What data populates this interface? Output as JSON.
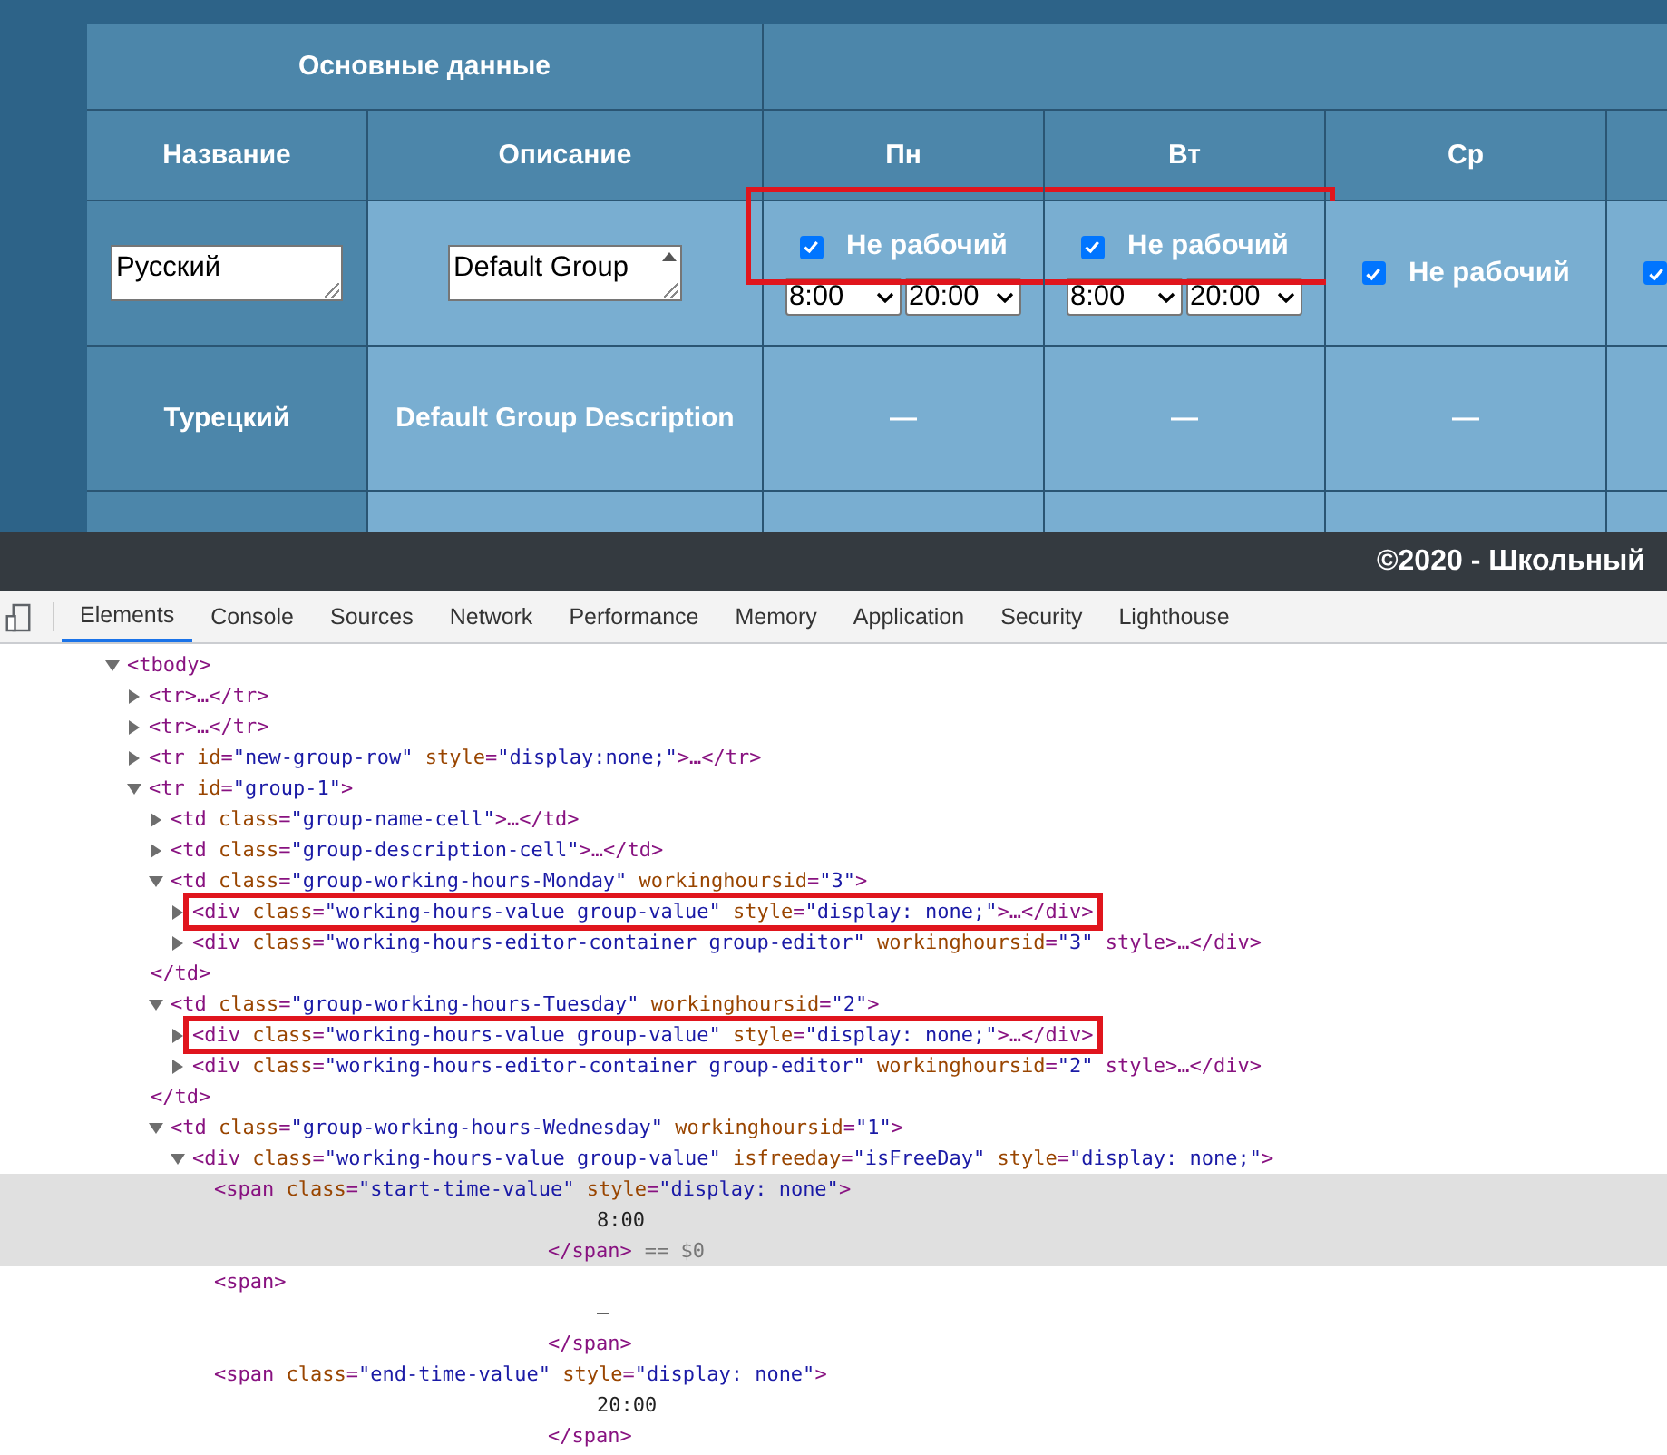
{
  "table": {
    "group_header": "Основные данные",
    "columns": [
      "Название",
      "Описание"
    ],
    "days": [
      {
        "label": "Пн",
        "not_working_label": "Не рабочий",
        "checked": true,
        "start": "8:00",
        "end": "20:00",
        "highlighted": true,
        "dash": "—"
      },
      {
        "label": "Вт",
        "not_working_label": "Не рабочий",
        "checked": true,
        "start": "8:00",
        "end": "20:00",
        "highlighted": true,
        "dash": "—"
      },
      {
        "label": "Ср",
        "not_working_label": "Не рабочий",
        "checked": true,
        "highlighted": false,
        "dash": "—"
      },
      {
        "checked": true,
        "highlighted": false
      }
    ],
    "editor_row": {
      "name": "Русский",
      "description": "Default Group"
    },
    "rows": [
      {
        "name": "Турецкий",
        "description": "Default Group Description"
      }
    ]
  },
  "footer": "©2020 - Школьный",
  "devtools": {
    "tabs": [
      {
        "label": "Elements",
        "selected": true
      },
      {
        "label": "Console",
        "selected": false
      },
      {
        "label": "Sources",
        "selected": false
      },
      {
        "label": "Network",
        "selected": false
      },
      {
        "label": "Performance",
        "selected": false
      },
      {
        "label": "Memory",
        "selected": false
      },
      {
        "label": "Application",
        "selected": false
      },
      {
        "label": "Security",
        "selected": false
      },
      {
        "label": "Lighthouse",
        "selected": false
      }
    ],
    "tree": [
      {
        "text": "<tbody>",
        "expanded": true,
        "children": [
          {
            "text": "<tr>…</tr>",
            "expanded": false
          },
          {
            "text": "<tr>…</tr>",
            "expanded": false
          },
          {
            "text": "<tr id=\"new-group-row\" style=\"display:none;\">…</tr>",
            "expanded": false
          },
          {
            "text": "<tr id=\"group-1\">",
            "expanded": true,
            "children": [
              {
                "text": "<td class=\"group-name-cell\">…</td>",
                "expanded": false
              },
              {
                "text": "<td class=\"group-description-cell\">…</td>",
                "expanded": false
              },
              {
                "text": "<td class=\"group-working-hours-Monday\" workinghoursid=\"3\">",
                "expanded": true,
                "closing": "</td>",
                "children": [
                  {
                    "text": "<div class=\"working-hours-value group-value\" style=\"display: none;\">…</div>",
                    "expanded": false,
                    "highlighted": true
                  },
                  {
                    "text": "<div class=\"working-hours-editor-container group-editor\" workinghoursid=\"3\" style>…</div>",
                    "expanded": false,
                    "highlighted": false
                  }
                ]
              },
              {
                "text": "<td class=\"group-working-hours-Tuesday\" workinghoursid=\"2\">",
                "expanded": true,
                "closing": "</td>",
                "children": [
                  {
                    "text": "<div class=\"working-hours-value group-value\" style=\"display: none;\">…</div>",
                    "expanded": false,
                    "highlighted": true
                  },
                  {
                    "text": "<div class=\"working-hours-editor-container group-editor\" workinghoursid=\"2\" style>…</div>",
                    "expanded": false,
                    "highlighted": false
                  }
                ]
              },
              {
                "text": "<td class=\"group-working-hours-Wednesday\" workinghoursid=\"1\">",
                "expanded": true,
                "children": [
                  {
                    "text": "<div class=\"working-hours-value group-value\" isfreeday=\"isFreeDay\" style=\"display: none;\">",
                    "expanded": true,
                    "children": [
                      {
                        "text": "<span class=\"start-time-value\" style=\"display: none\">",
                        "content": "8:00",
                        "closing": "</span>",
                        "suffix": "== $0",
                        "selected": true
                      },
                      {
                        "text": "<span>",
                        "content": "–",
                        "closing": "</span>",
                        "selected": false
                      },
                      {
                        "text": "<span class=\"end-time-value\" style=\"display: none\">",
                        "content": "20:00",
                        "closing": "</span>",
                        "selected": false
                      }
                    ]
                  }
                ]
              }
            ]
          }
        ]
      }
    ]
  }
}
